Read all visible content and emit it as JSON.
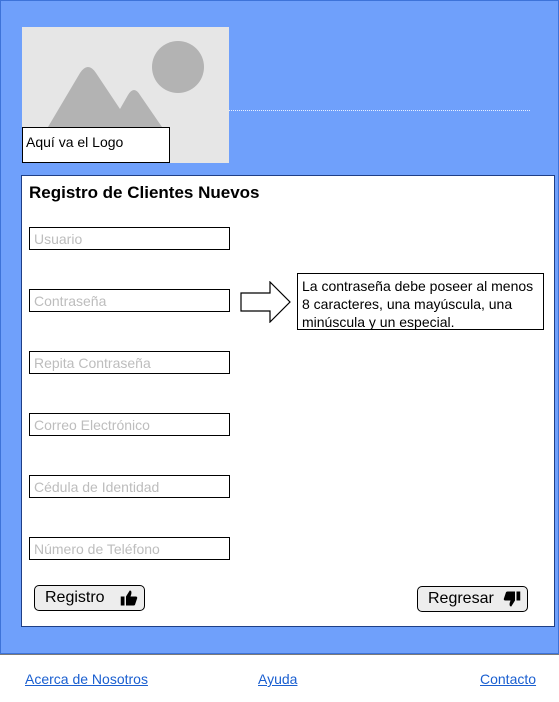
{
  "header": {
    "logo_caption": "Aquí va el Logo",
    "logo_icon": "image-placeholder-icon"
  },
  "form": {
    "title": "Registro de Clientes Nuevos",
    "fields": [
      {
        "placeholder": "Usuario",
        "value": ""
      },
      {
        "placeholder": "Contraseña",
        "value": ""
      },
      {
        "placeholder": "Repita Contraseña",
        "value": ""
      },
      {
        "placeholder": "Correo Electrónico",
        "value": ""
      },
      {
        "placeholder": "Cédula de Identidad",
        "value": ""
      },
      {
        "placeholder": "Número de Teléfono",
        "value": ""
      }
    ],
    "password_hint": "La contraseña debe poseer al menos 8 caracteres, una mayúscula, una minúscula y un especial.",
    "buttons": {
      "submit_label": "Registro",
      "submit_icon": "thumbs-up-icon",
      "back_label": "Regresar",
      "back_icon": "thumbs-down-icon"
    }
  },
  "footer": {
    "links": [
      "Acerca de Nosotros",
      "Ayuda",
      "Contacto"
    ]
  },
  "colors": {
    "header_background": "#6fa0fb",
    "link": "#1a5fd0",
    "placeholder_text": "#bdbdbd"
  }
}
